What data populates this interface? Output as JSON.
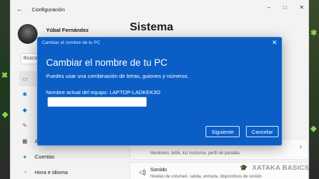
{
  "window": {
    "title": "Configuración",
    "back_icon": "back-arrow-icon",
    "controls": [
      "–",
      "□",
      "✕"
    ]
  },
  "profile": {
    "name": "Yúbal Fernández"
  },
  "search": {
    "placeholder": "Buscar"
  },
  "nav": {
    "items": [
      {
        "label": "",
        "icon": "system-icon",
        "glyph": "▭"
      },
      {
        "label": "",
        "icon": "bluetooth-icon",
        "glyph": "✱"
      },
      {
        "label": "",
        "icon": "network-icon",
        "glyph": "◆"
      },
      {
        "label": "",
        "icon": "personalization-icon",
        "glyph": "✎"
      },
      {
        "label": "A",
        "icon": "apps-icon",
        "glyph": "▦"
      },
      {
        "label": "Cuentas",
        "icon": "accounts-icon",
        "glyph": "●"
      },
      {
        "label": "Hora e idioma",
        "icon": "time-language-icon",
        "glyph": "◔"
      }
    ]
  },
  "main": {
    "title": "Sistema",
    "cards": [
      {
        "title": "",
        "subtitle": "Monitores, brillo, luz nocturna, perfil de pantalla",
        "icon": "display-icon",
        "glyph": ""
      },
      {
        "title": "Sonido",
        "subtitle": "Niveles de volumen, salida, entrada, dispositivos de sonido",
        "icon": "sound-icon",
        "glyph": "◁)"
      }
    ]
  },
  "dialog": {
    "caption": "Cambiar el nombre de tu PC",
    "title": "Cambiar el nombre de tu PC",
    "description": "Puedes usar una combinación de letras, guiones y números.",
    "current_name_label": "Nombre actual del equipo: LAPTOP-LADKEK3O",
    "input_value": "",
    "next_label": "Siguiente",
    "cancel_label": "Cancelar",
    "close_glyph": "✕",
    "background_color": "#0a5ec6"
  },
  "watermark": {
    "text": "XATAKA BASICS",
    "icon": "graduation-cap-icon"
  }
}
